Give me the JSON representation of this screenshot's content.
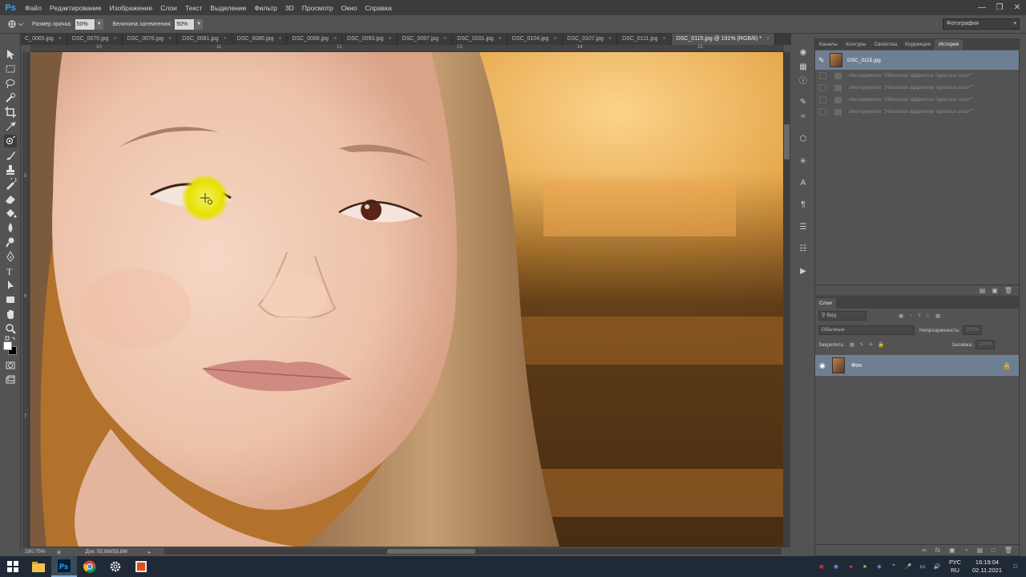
{
  "app": {
    "logo": "Ps"
  },
  "menu": [
    "Файл",
    "Редактирование",
    "Изображение",
    "Слои",
    "Текст",
    "Выделение",
    "Фильтр",
    "3D",
    "Просмотр",
    "Окно",
    "Справка"
  ],
  "options": {
    "pupil_size_label": "Размер зрачка:",
    "pupil_size_value": "50%",
    "darken_label": "Величина затемнения:",
    "darken_value": "50%",
    "workspace": "Фотография"
  },
  "tabs": [
    {
      "label": "C_0065.jpg",
      "active": false
    },
    {
      "label": "DSC_0070.jpg",
      "active": false
    },
    {
      "label": "DSC_0076.jpg",
      "active": false
    },
    {
      "label": "DSC_0081.jpg",
      "active": false
    },
    {
      "label": "DSC_0085.jpg",
      "active": false
    },
    {
      "label": "DSC_0088.jpg",
      "active": false
    },
    {
      "label": "DSC_0093.jpg",
      "active": false
    },
    {
      "label": "DSC_0097.jpg",
      "active": false
    },
    {
      "label": "DSC_0101.jpg",
      "active": false
    },
    {
      "label": "DSC_0104.jpg",
      "active": false
    },
    {
      "label": "DSC_0107.jpg",
      "active": false
    },
    {
      "label": "DSC_0111.jpg",
      "active": false
    },
    {
      "label": "DSC_0115.jpg @ 191% (RGB/8) *",
      "active": true
    }
  ],
  "ruler": {
    "h": [
      "10",
      "11",
      "12",
      "13",
      "14",
      "15"
    ],
    "v": [
      "5",
      "6",
      "7"
    ]
  },
  "status": {
    "zoom": "190.75%",
    "doc": "Док: 55,8M/55,8M"
  },
  "history": {
    "tabs": [
      "Каналы",
      "Контуры",
      "Свойства",
      "Коррекция",
      "История"
    ],
    "active_tab": "История",
    "snapshot": "DSC_0115.jpg",
    "items": [
      "Инструмент \"Удаление эффекта \"красных глаз\"\"",
      "Инструмент \"Удаление эффекта \"красных глаз\"\"",
      "Инструмент \"Удаление эффекта \"красных глаз\"\"",
      "Инструмент \"Удаление эффекта \"красных глаз\"\""
    ]
  },
  "layers": {
    "tab": "Слои",
    "kind_filter": "Вид",
    "blend_mode": "Обычные",
    "opacity_label": "Непрозрачность:",
    "opacity_value": "100%",
    "lock_label": "Закрепить:",
    "fill_label": "Заливка:",
    "fill_value": "100%",
    "layer_name": "Фон"
  },
  "taskbar": {
    "lang": "РУС",
    "lang_sub": "RU",
    "time": "16:19:04",
    "date": "02.11.2021"
  }
}
